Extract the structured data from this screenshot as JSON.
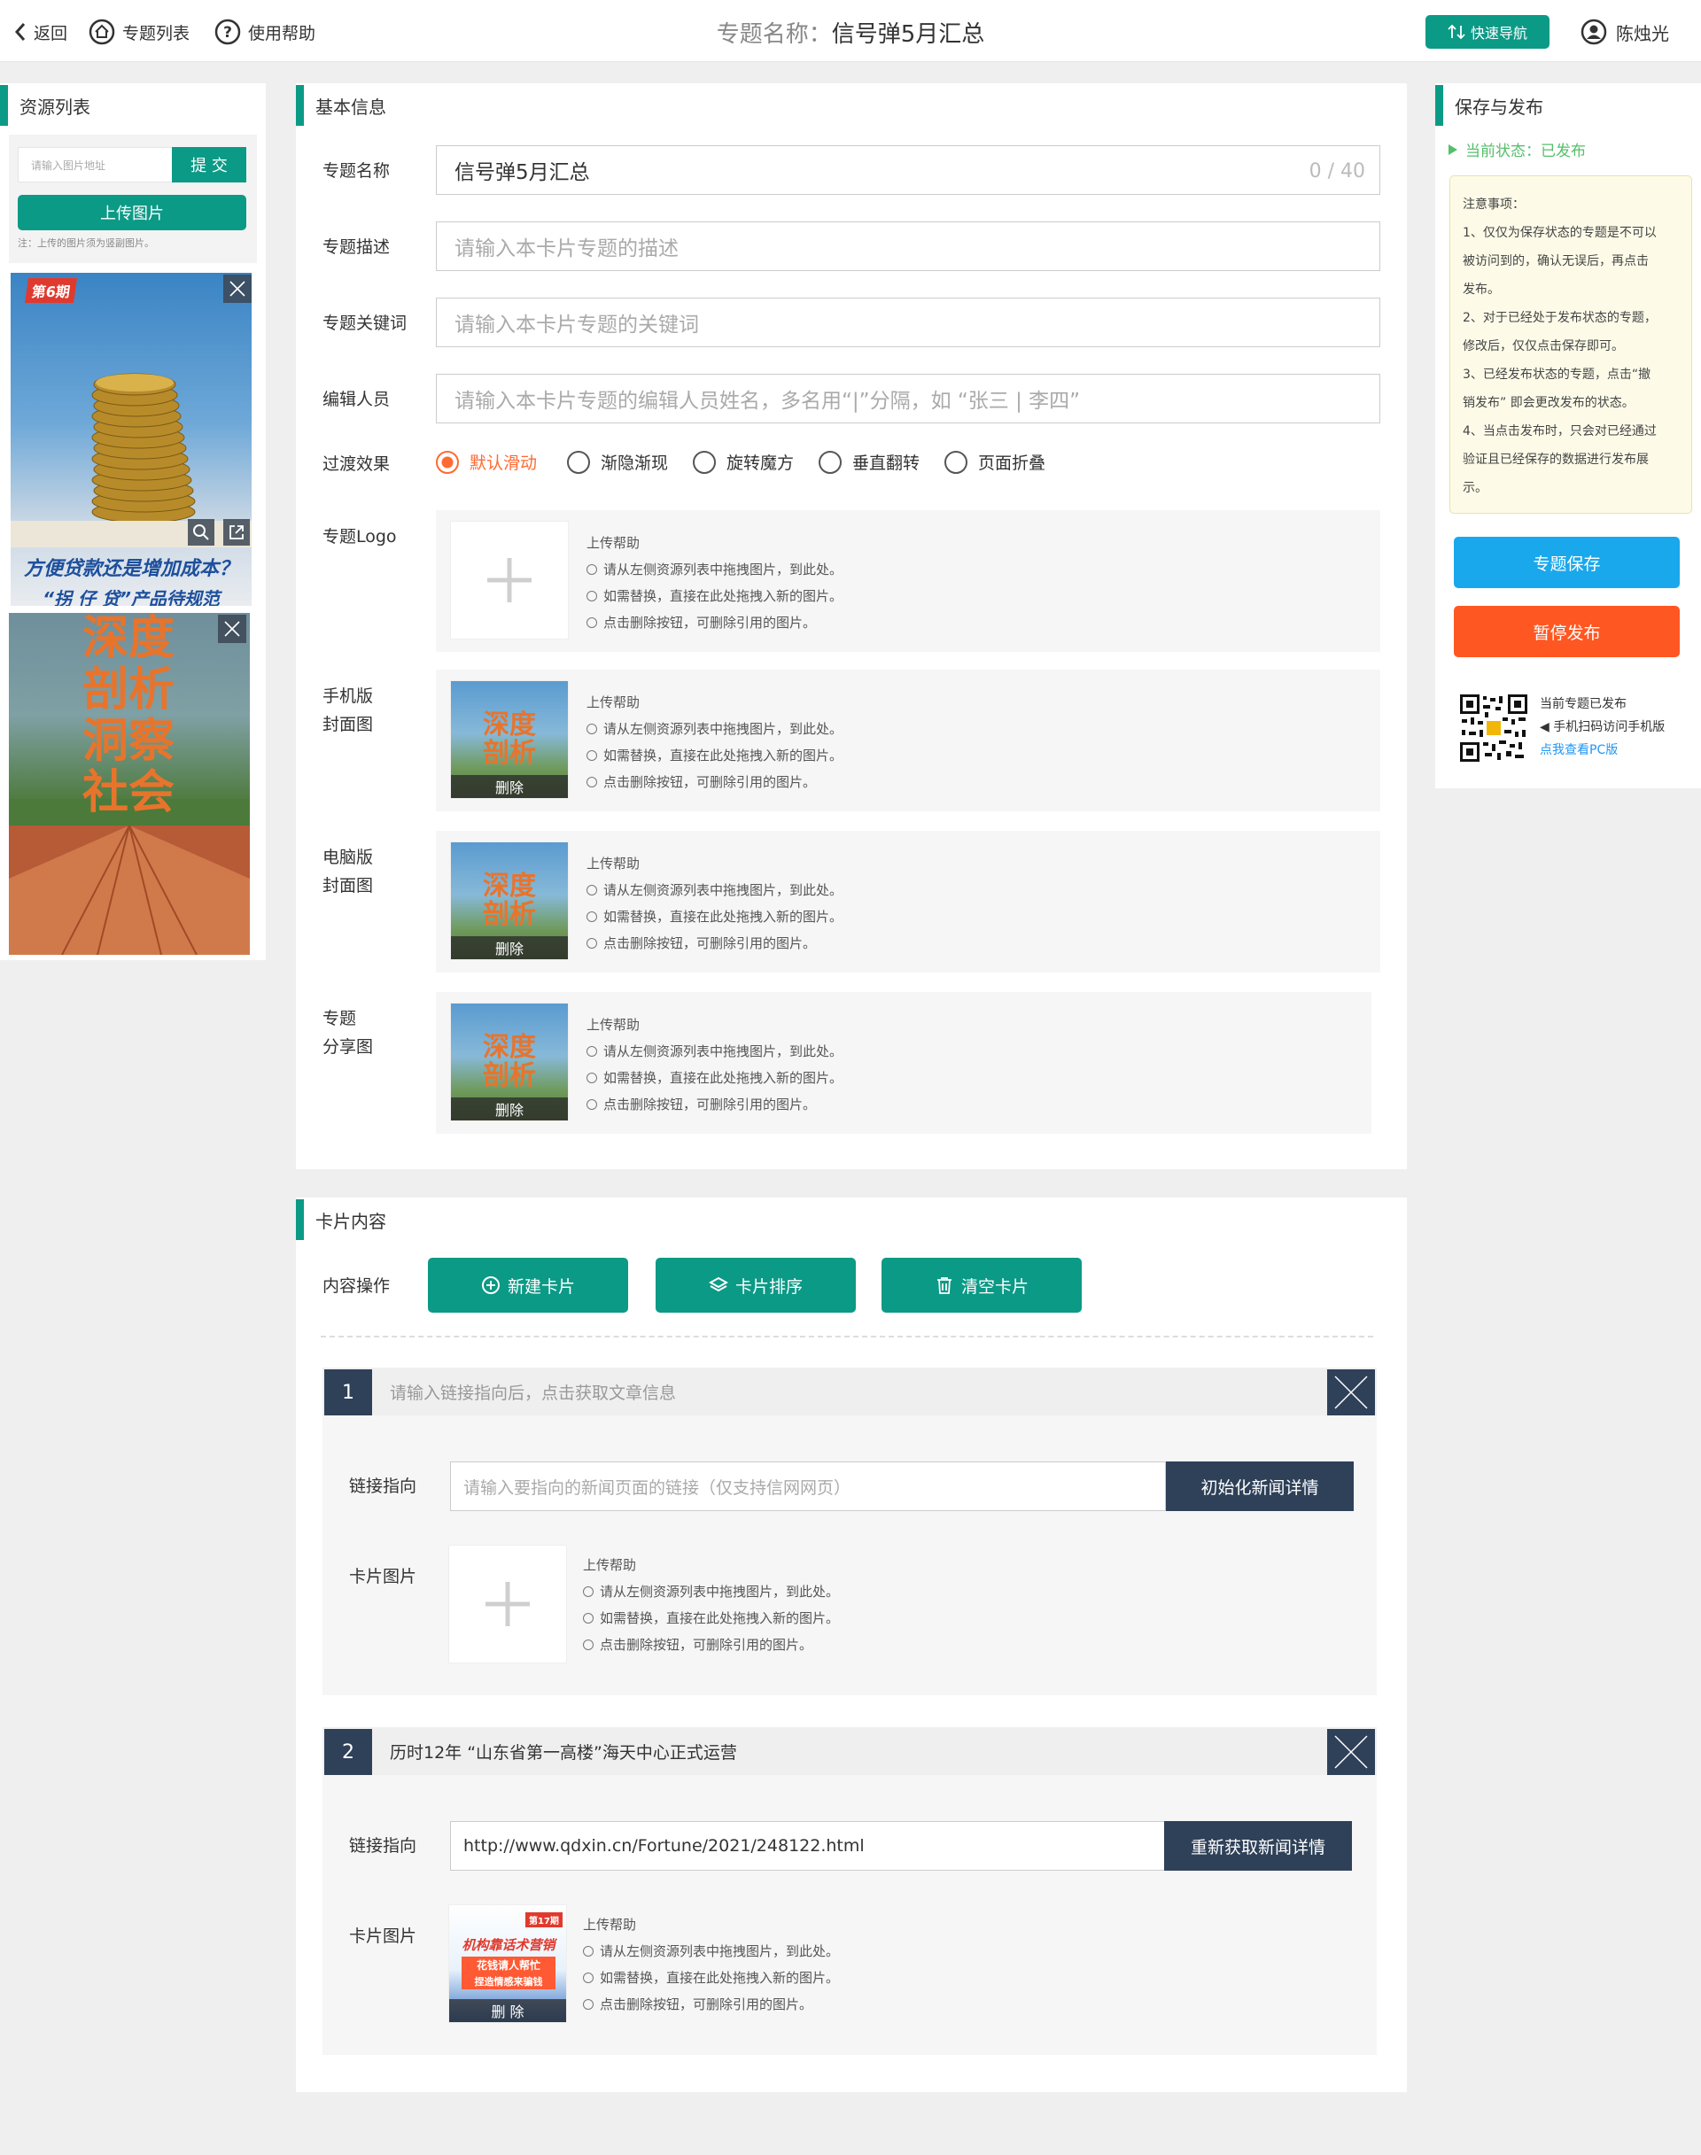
{
  "topbar": {
    "back": "返回",
    "topic_list": "专题列表",
    "help": "使用帮助",
    "title_label": "专题名称：",
    "title_value": "信号弹5月汇总",
    "quick_nav": "快速导航",
    "user": "陈烛光"
  },
  "resources": {
    "title": "资源列表",
    "search_placeholder": "请输入图片地址",
    "submit": "提 交",
    "upload": "上传图片",
    "note": "注：上传的图片须为竖副图片。",
    "thumb1_badge": "第6期",
    "thumb1_headline": "方便贷款还是增加成本？",
    "thumb1_subline": "“拐 仔 贷”产品待规范",
    "thumb2_text": "深度剖析 洞察社会"
  },
  "basic": {
    "title": "基本信息",
    "name_label": "专题名称",
    "name_value": "信号弹5月汇总",
    "name_counter": "0 / 40",
    "desc_label": "专题描述",
    "desc_placeholder": "请输入本卡片专题的描述",
    "kw_label": "专题关键词",
    "kw_placeholder": "请输入本卡片专题的关键词",
    "editor_label": "编辑人员",
    "editor_placeholder": "请输入本卡片专题的编辑人员姓名，多名用“|”分隔，如 “张三 | 李四”",
    "effect_label": "过渡效果",
    "effects": [
      "默认滑动",
      "渐隐渐现",
      "旋转魔方",
      "垂直翻转",
      "页面折叠"
    ],
    "selected_effect": "默认滑动",
    "logo_label": "专题Logo",
    "mobile_cover_label_1": "手机版",
    "mobile_cover_label_2": "封面图",
    "pc_cover_label_1": "电脑版",
    "pc_cover_label_2": "封面图",
    "share_label_1": "专题",
    "share_label_2": "分享图",
    "help_title": "上传帮助",
    "help_1": "请从左侧资源列表中拖拽图片，到此处。",
    "help_2": "如需替换，直接在此处拖拽入新的图片。",
    "help_3": "点击删除按钮，可删除引用的图片。",
    "delete": "删除",
    "cover_text": "深度剖析"
  },
  "cards": {
    "title": "卡片内容",
    "ops_label": "内容操作",
    "new_card": "新建卡片",
    "sort_cards": "卡片排序",
    "clear_cards": "清空卡片",
    "link_label": "链接指向",
    "image_label": "卡片图片",
    "items": [
      {
        "num": "1",
        "title": "请输入链接指向后，点击获取文章信息",
        "link_placeholder": "请输入要指向的新闻页面的链接（仅支持信网网页）",
        "link_value": "",
        "button": "初始化新闻详情"
      },
      {
        "num": "2",
        "title": "历时12年 “山东省第一高楼”海天中心正式运营",
        "link_placeholder": "",
        "link_value": "http://www.qdxin.cn/Fortune/2021/248122.html",
        "button": "重新获取新闻详情",
        "image_badge": "第17期",
        "image_text_1": "机构靠话术营销",
        "image_text_2": "花钱请人帮忙",
        "image_text_3": "捏造情感来骗钱",
        "delete": "删 除"
      }
    ]
  },
  "publish": {
    "title": "保存与发布",
    "status": "当前状态：已发布",
    "notes_title": "注意事项：",
    "notes": [
      "1、仅仅为保存状态的专题是不可以",
      "被访问到的，确认无误后，再点击",
      "发布。",
      "2、对于已经处于发布状态的专题，",
      "修改后，仅仅点击保存即可。",
      "3、已经发布状态的专题，点击“撤",
      "销发布” 即会更改发布的状态。",
      "4、当点击发布时，只会对已经通过",
      "验证且已经保存的数据进行发布展",
      "示。"
    ],
    "save": "专题保存",
    "pause": "暂停发布",
    "qr_1": "当前专题已发布",
    "qr_2": "◀ 手机扫码访问手机版",
    "qr_3": "点我查看PC版"
  },
  "colors": {
    "accent": "#0b9a86",
    "dark": "#2f4159",
    "save": "#1aa8ec",
    "pause": "#ff5722",
    "radio_on": "#ff6a33",
    "status": "#55bf6a"
  }
}
